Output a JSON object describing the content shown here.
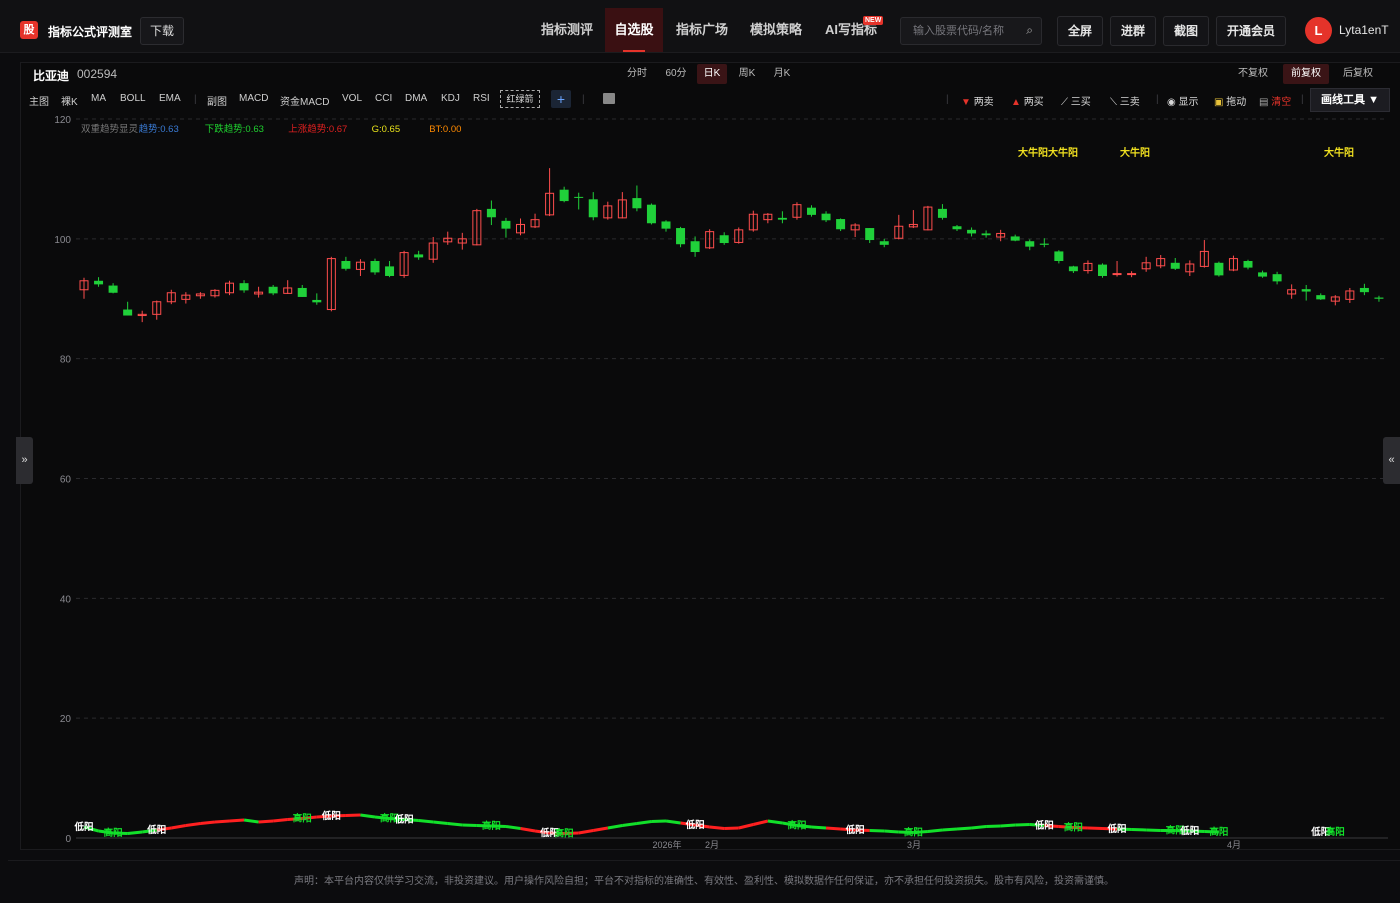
{
  "app": {
    "logo_char": "股",
    "name": "指标公式评测室",
    "download_label": "下载"
  },
  "nav": [
    {
      "label": "指标测评",
      "active": false
    },
    {
      "label": "自选股",
      "active": true
    },
    {
      "label": "指标广场",
      "active": false
    },
    {
      "label": "模拟策略",
      "active": false
    },
    {
      "label": "AI写指标",
      "active": false,
      "badge": "NEW"
    }
  ],
  "search": {
    "placeholder": "输入股票代码/名称",
    "icon": "search-icon"
  },
  "header_buttons": [
    "全屏",
    "进群",
    "截图",
    "开通会员"
  ],
  "user": {
    "avatar_letter": "L",
    "name": "Lyta1enT"
  },
  "stock": {
    "name": "比亚迪",
    "code": "002594"
  },
  "periods": [
    "分时",
    "60分",
    "日K",
    "周K",
    "月K"
  ],
  "active_period": "日K",
  "adjust": [
    "不复权",
    "前复权",
    "后复权"
  ],
  "active_adjust": "前复权",
  "indicators": {
    "main": [
      "主图",
      "裸K",
      "MA",
      "BOLL",
      "EMA"
    ],
    "sub": [
      "副图",
      "MACD",
      "资金MACD",
      "VOL",
      "CCI",
      "DMA",
      "KDJ",
      "RSI"
    ],
    "custom": "红绿箭",
    "add": "+"
  },
  "tools": [
    {
      "label": "两卖",
      "icon": "down-triangle-icon",
      "color": "#e5332a"
    },
    {
      "label": "两买",
      "icon": "up-triangle-icon",
      "color": "#e5332a"
    },
    {
      "label": "三买",
      "icon": "line-chart-icon",
      "color": "#dddddd"
    },
    {
      "label": "三卖",
      "icon": "line-chart-icon",
      "color": "#dddddd"
    },
    {
      "label": "显示",
      "icon": "eye-icon",
      "color": "#dddddd"
    },
    {
      "label": "拖动",
      "icon": "lock-icon",
      "color": "#dddddd"
    },
    {
      "label": "清空",
      "icon": "trash-icon",
      "color": "#e5332a"
    }
  ],
  "draw_tool_label": "画线工具 ▼",
  "legend": [
    {
      "label": "双重趋势显灵",
      "color": "#777777"
    },
    {
      "label": "趋势:0.63",
      "color": "#3a7bd5"
    },
    {
      "label": "下跌趋势:0.63",
      "color": "#1fd12f"
    },
    {
      "label": "上涨趋势:0.67",
      "color": "#e02020"
    },
    {
      "label": "G:0.65",
      "color": "#e8e21a"
    },
    {
      "label": "BT:0.00",
      "color": "#ff8a00"
    }
  ],
  "signals": [
    "大牛阳大牛阳",
    "大牛阳",
    "大牛阳"
  ],
  "chart_data": {
    "type": "candlestick",
    "yticks": [
      0,
      20,
      40,
      60,
      80,
      100,
      120
    ],
    "ylim": [
      0,
      120
    ],
    "xticks": [
      "2026年",
      "2月",
      "3月",
      "4月"
    ],
    "candles": [
      {
        "o": 91.5,
        "h": 93.5,
        "l": 90.0,
        "c": 93.0
      },
      {
        "o": 93.0,
        "h": 93.6,
        "l": 92.0,
        "c": 92.4
      },
      {
        "o": 92.2,
        "h": 92.6,
        "l": 90.9,
        "c": 91.0
      },
      {
        "o": 88.2,
        "h": 89.5,
        "l": 87.2,
        "c": 87.2
      },
      {
        "o": 87.2,
        "h": 88.0,
        "l": 86.1,
        "c": 87.4
      },
      {
        "o": 87.4,
        "h": 89.7,
        "l": 86.5,
        "c": 89.5
      },
      {
        "o": 89.5,
        "h": 91.5,
        "l": 89.1,
        "c": 91.0
      },
      {
        "o": 89.9,
        "h": 91.1,
        "l": 89.2,
        "c": 90.6
      },
      {
        "o": 90.5,
        "h": 91.1,
        "l": 90.0,
        "c": 90.8
      },
      {
        "o": 90.5,
        "h": 91.6,
        "l": 90.2,
        "c": 91.4
      },
      {
        "o": 91.0,
        "h": 93.0,
        "l": 90.6,
        "c": 92.6
      },
      {
        "o": 92.6,
        "h": 93.1,
        "l": 91.0,
        "c": 91.4
      },
      {
        "o": 90.8,
        "h": 92.0,
        "l": 90.2,
        "c": 91.1
      },
      {
        "o": 92.0,
        "h": 92.3,
        "l": 90.6,
        "c": 90.9
      },
      {
        "o": 90.9,
        "h": 93.1,
        "l": 90.8,
        "c": 91.8
      },
      {
        "o": 91.8,
        "h": 92.3,
        "l": 90.3,
        "c": 90.3
      },
      {
        "o": 89.8,
        "h": 90.9,
        "l": 89.0,
        "c": 89.4
      },
      {
        "o": 88.2,
        "h": 97.0,
        "l": 87.9,
        "c": 96.7
      },
      {
        "o": 96.3,
        "h": 97.0,
        "l": 94.7,
        "c": 95.0
      },
      {
        "o": 94.9,
        "h": 96.6,
        "l": 93.8,
        "c": 96.1
      },
      {
        "o": 96.3,
        "h": 96.7,
        "l": 94.0,
        "c": 94.4
      },
      {
        "o": 95.4,
        "h": 96.3,
        "l": 93.6,
        "c": 93.8
      },
      {
        "o": 93.9,
        "h": 98.0,
        "l": 93.5,
        "c": 97.7
      },
      {
        "o": 97.4,
        "h": 98.0,
        "l": 96.5,
        "c": 96.9
      },
      {
        "o": 96.6,
        "h": 100.3,
        "l": 96.0,
        "c": 99.3
      },
      {
        "o": 99.5,
        "h": 101.2,
        "l": 99.0,
        "c": 100.1
      },
      {
        "o": 99.3,
        "h": 101.0,
        "l": 98.2,
        "c": 100.0
      },
      {
        "o": 99.0,
        "h": 105.0,
        "l": 98.9,
        "c": 104.7
      },
      {
        "o": 105.0,
        "h": 106.4,
        "l": 102.3,
        "c": 103.6
      },
      {
        "o": 103.0,
        "h": 103.5,
        "l": 100.2,
        "c": 101.7
      },
      {
        "o": 101.0,
        "h": 103.4,
        "l": 100.6,
        "c": 102.4
      },
      {
        "o": 102.0,
        "h": 104.2,
        "l": 101.8,
        "c": 103.2
      },
      {
        "o": 104.0,
        "h": 111.8,
        "l": 103.8,
        "c": 107.6
      },
      {
        "o": 108.2,
        "h": 108.7,
        "l": 106.1,
        "c": 106.3
      },
      {
        "o": 107.0,
        "h": 107.7,
        "l": 104.9,
        "c": 106.9
      },
      {
        "o": 106.6,
        "h": 107.8,
        "l": 103.1,
        "c": 103.6
      },
      {
        "o": 103.5,
        "h": 106.2,
        "l": 103.2,
        "c": 105.5
      },
      {
        "o": 103.5,
        "h": 107.8,
        "l": 103.4,
        "c": 106.5
      },
      {
        "o": 106.8,
        "h": 108.9,
        "l": 104.6,
        "c": 105.1
      },
      {
        "o": 105.7,
        "h": 105.9,
        "l": 102.4,
        "c": 102.6
      },
      {
        "o": 102.9,
        "h": 103.1,
        "l": 101.2,
        "c": 101.7
      },
      {
        "o": 101.8,
        "h": 102.0,
        "l": 98.6,
        "c": 99.1
      },
      {
        "o": 99.6,
        "h": 100.4,
        "l": 97.0,
        "c": 97.8
      },
      {
        "o": 98.5,
        "h": 101.6,
        "l": 98.3,
        "c": 101.2
      },
      {
        "o": 100.6,
        "h": 101.1,
        "l": 99.0,
        "c": 99.3
      },
      {
        "o": 99.4,
        "h": 101.9,
        "l": 99.2,
        "c": 101.5
      },
      {
        "o": 101.5,
        "h": 104.7,
        "l": 101.2,
        "c": 104.1
      },
      {
        "o": 103.2,
        "h": 104.3,
        "l": 102.6,
        "c": 104.1
      },
      {
        "o": 103.5,
        "h": 104.6,
        "l": 102.6,
        "c": 103.2
      },
      {
        "o": 103.6,
        "h": 106.1,
        "l": 103.2,
        "c": 105.7
      },
      {
        "o": 105.2,
        "h": 105.6,
        "l": 103.7,
        "c": 104.0
      },
      {
        "o": 104.2,
        "h": 104.6,
        "l": 102.8,
        "c": 103.1
      },
      {
        "o": 103.3,
        "h": 103.4,
        "l": 101.3,
        "c": 101.6
      },
      {
        "o": 101.5,
        "h": 102.6,
        "l": 100.3,
        "c": 102.3
      },
      {
        "o": 101.8,
        "h": 101.8,
        "l": 99.3,
        "c": 99.8
      },
      {
        "o": 99.6,
        "h": 100.0,
        "l": 98.6,
        "c": 99.0
      },
      {
        "o": 100.1,
        "h": 104.0,
        "l": 99.9,
        "c": 102.1
      },
      {
        "o": 102.0,
        "h": 104.8,
        "l": 101.8,
        "c": 102.4
      },
      {
        "o": 101.5,
        "h": 105.5,
        "l": 101.4,
        "c": 105.3
      },
      {
        "o": 105.0,
        "h": 105.8,
        "l": 103.2,
        "c": 103.5
      },
      {
        "o": 102.1,
        "h": 102.3,
        "l": 101.3,
        "c": 101.6
      },
      {
        "o": 101.5,
        "h": 101.9,
        "l": 100.4,
        "c": 100.9
      },
      {
        "o": 100.9,
        "h": 101.4,
        "l": 100.2,
        "c": 100.6
      },
      {
        "o": 100.3,
        "h": 101.5,
        "l": 99.6,
        "c": 100.9
      },
      {
        "o": 100.4,
        "h": 100.7,
        "l": 99.6,
        "c": 99.7
      },
      {
        "o": 99.6,
        "h": 99.9,
        "l": 98.1,
        "c": 98.7
      },
      {
        "o": 99.2,
        "h": 100.1,
        "l": 98.6,
        "c": 99.0
      },
      {
        "o": 97.9,
        "h": 98.1,
        "l": 95.9,
        "c": 96.3
      },
      {
        "o": 95.4,
        "h": 95.5,
        "l": 94.3,
        "c": 94.6
      },
      {
        "o": 94.7,
        "h": 96.4,
        "l": 94.2,
        "c": 95.9
      },
      {
        "o": 95.7,
        "h": 95.9,
        "l": 93.5,
        "c": 93.8
      },
      {
        "o": 94.2,
        "h": 96.3,
        "l": 93.7,
        "c": 94.2
      },
      {
        "o": 94.1,
        "h": 94.6,
        "l": 93.6,
        "c": 94.2
      },
      {
        "o": 95.0,
        "h": 97.0,
        "l": 94.5,
        "c": 96.0
      },
      {
        "o": 95.5,
        "h": 97.3,
        "l": 95.1,
        "c": 96.7
      },
      {
        "o": 96.0,
        "h": 96.8,
        "l": 94.8,
        "c": 95.0
      },
      {
        "o": 94.5,
        "h": 96.4,
        "l": 93.8,
        "c": 95.8
      },
      {
        "o": 95.4,
        "h": 99.8,
        "l": 95.2,
        "c": 97.9
      },
      {
        "o": 96.0,
        "h": 96.2,
        "l": 93.7,
        "c": 93.9
      },
      {
        "o": 94.8,
        "h": 97.2,
        "l": 94.6,
        "c": 96.7
      },
      {
        "o": 96.3,
        "h": 96.5,
        "l": 94.9,
        "c": 95.2
      },
      {
        "o": 94.4,
        "h": 94.7,
        "l": 93.5,
        "c": 93.7
      },
      {
        "o": 94.1,
        "h": 94.5,
        "l": 92.4,
        "c": 92.9
      },
      {
        "o": 90.8,
        "h": 92.4,
        "l": 90.0,
        "c": 91.5
      },
      {
        "o": 91.6,
        "h": 92.3,
        "l": 89.7,
        "c": 91.2
      },
      {
        "o": 90.6,
        "h": 90.9,
        "l": 89.8,
        "c": 89.9
      },
      {
        "o": 89.6,
        "h": 90.6,
        "l": 88.9,
        "c": 90.3
      },
      {
        "o": 89.9,
        "h": 91.8,
        "l": 89.3,
        "c": 91.3
      },
      {
        "o": 91.8,
        "h": 92.5,
        "l": 90.6,
        "c": 91.1
      },
      {
        "o": 90.2,
        "h": 90.5,
        "l": 89.5,
        "c": 90.0
      }
    ],
    "signal_line": {
      "red_segments": [
        [
          5,
          10
        ],
        [
          12,
          18
        ],
        [
          30,
          35
        ],
        [
          41,
          46
        ],
        [
          51,
          53
        ],
        [
          66,
          70
        ]
      ],
      "values": [
        1.8,
        1.0,
        0.6,
        0.5,
        0.8,
        1.2,
        1.6,
        2.1,
        2.5,
        2.8,
        3.0,
        3.2,
        2.8,
        3.0,
        3.3,
        3.5,
        3.8,
        4.0,
        4.1,
        4.2,
        3.8,
        3.5,
        3.3,
        3.1,
        2.8,
        2.5,
        2.2,
        2.1,
        2.0,
        1.9,
        1.5,
        1.0,
        0.6,
        0.5,
        0.6,
        1.1,
        1.6,
        2.1,
        2.5,
        2.9,
        3.0,
        2.6,
        2.2,
        1.8,
        1.5,
        1.6,
        2.3,
        3.0,
        2.6,
        2.1,
        1.8,
        1.6,
        1.4,
        1.2,
        1.1,
        1.0,
        0.8,
        0.7,
        0.9,
        1.2,
        1.4,
        1.6,
        1.9,
        2.0,
        2.2,
        2.3,
        2.1,
        1.9,
        1.7,
        1.6,
        1.5,
        1.4,
        1.3,
        1.2,
        1.1,
        1.1,
        1.0,
        0.9,
        0.8
      ]
    },
    "signal_labels": [
      {
        "i": 0,
        "text": "低阳"
      },
      {
        "i": 2,
        "text": "高阳"
      },
      {
        "i": 5,
        "text": "低阳"
      },
      {
        "i": 15,
        "text": "高阳"
      },
      {
        "i": 17,
        "text": "低阳"
      },
      {
        "i": 21,
        "text": "高阳"
      },
      {
        "i": 22,
        "text": "低阳"
      },
      {
        "i": 28,
        "text": "高阳"
      },
      {
        "i": 32,
        "text": "低阳"
      },
      {
        "i": 33,
        "text": "高阳"
      },
      {
        "i": 42,
        "text": "低阳"
      },
      {
        "i": 49,
        "text": "高阳"
      },
      {
        "i": 53,
        "text": "低阳"
      },
      {
        "i": 57,
        "text": "高阳"
      },
      {
        "i": 66,
        "text": "低阳"
      },
      {
        "i": 68,
        "text": "高阳"
      },
      {
        "i": 71,
        "text": "低阳"
      },
      {
        "i": 75,
        "text": "高阳"
      },
      {
        "i": 76,
        "text": "低阳"
      },
      {
        "i": 78,
        "text": "高阳"
      },
      {
        "i": 85,
        "text": "低阳"
      },
      {
        "i": 86,
        "text": "高阳"
      }
    ]
  },
  "footer": "声明：本平台内容仅供学习交流，非投资建议。用户操作风险自担；平台不对指标的准确性、有效性、盈利性、模拟数据作任何保证，亦不承担任何投资损失。股市有风险，投资需谨慎。"
}
